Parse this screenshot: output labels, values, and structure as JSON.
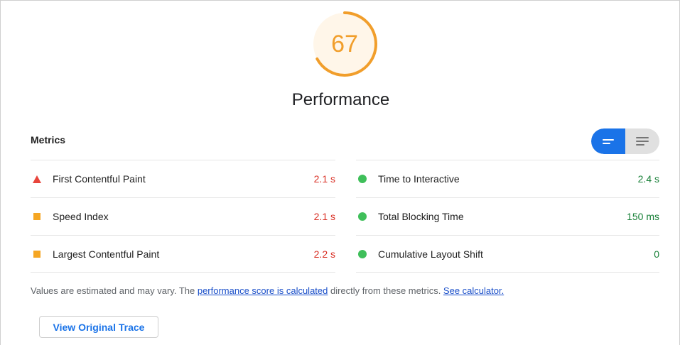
{
  "gauge": {
    "score": "67",
    "title": "Performance",
    "color": "#f19e2b",
    "fill_fraction": 0.67
  },
  "metrics": {
    "header": "Metrics",
    "view_toggle": {
      "active": "list-view",
      "options": [
        "list-view",
        "table-view"
      ],
      "active_color": "#1a73e8"
    },
    "left": [
      {
        "label": "First Contentful Paint",
        "value": "2.1 s",
        "status": "fail",
        "icon": "red-triangle-icon"
      },
      {
        "label": "Speed Index",
        "value": "2.1 s",
        "status": "average",
        "icon": "orange-square-icon"
      },
      {
        "label": "Largest Contentful Paint",
        "value": "2.2 s",
        "status": "average",
        "icon": "orange-square-icon"
      }
    ],
    "right": [
      {
        "label": "Time to Interactive",
        "value": "2.4 s",
        "status": "pass",
        "icon": "green-circle-icon"
      },
      {
        "label": "Total Blocking Time",
        "value": "150 ms",
        "status": "pass",
        "icon": "green-circle-icon"
      },
      {
        "label": "Cumulative Layout Shift",
        "value": "0",
        "status": "pass",
        "icon": "green-circle-icon"
      }
    ]
  },
  "note": {
    "prefix": "Values are estimated and may vary. The ",
    "link1": "performance score is calculated",
    "middle": " directly from these metrics. ",
    "link2": "See calculator."
  },
  "trace_button": {
    "label": "View Original Trace"
  },
  "colors": {
    "fail": "#d93025",
    "average": "#f5a623",
    "pass": "#188038"
  }
}
